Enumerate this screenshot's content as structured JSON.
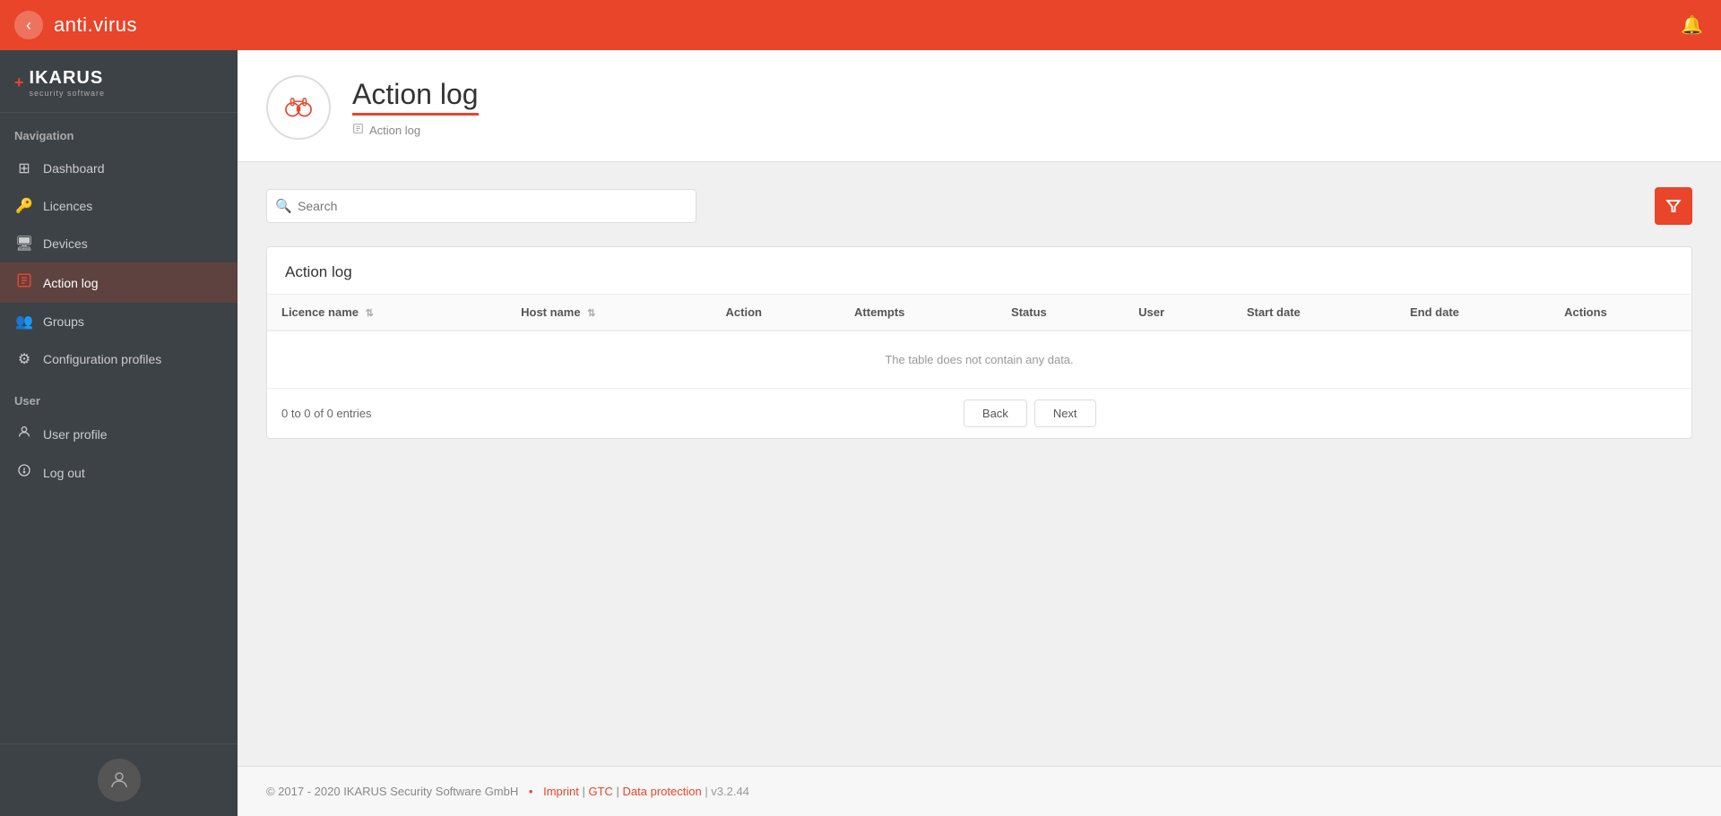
{
  "topbar": {
    "title": "anti.virus",
    "back_label": "‹"
  },
  "sidebar": {
    "logo_cross": "+",
    "logo_name": "IKARUS",
    "logo_sub": "security software",
    "nav_label": "Navigation",
    "nav_items": [
      {
        "id": "dashboard",
        "label": "Dashboard",
        "icon": "⊞",
        "active": false
      },
      {
        "id": "licences",
        "label": "Licences",
        "icon": "🔑",
        "active": false
      },
      {
        "id": "devices",
        "label": "Devices",
        "icon": "🖥",
        "active": false
      },
      {
        "id": "action-log",
        "label": "Action log",
        "icon": "📋",
        "active": true
      },
      {
        "id": "groups",
        "label": "Groups",
        "icon": "👥",
        "active": false
      },
      {
        "id": "configuration-profiles",
        "label": "Configuration profiles",
        "icon": "⚙",
        "active": false
      }
    ],
    "user_label": "User",
    "user_items": [
      {
        "id": "user-profile",
        "label": "User profile",
        "icon": "👤"
      },
      {
        "id": "log-out",
        "label": "Log out",
        "icon": "⏻"
      }
    ]
  },
  "page": {
    "title": "Action log",
    "icon": "🔭",
    "breadcrumb_icon": "📋",
    "breadcrumb_label": "Action log"
  },
  "search": {
    "placeholder": "Search"
  },
  "table": {
    "section_title": "Action log",
    "columns": [
      {
        "id": "licence-name",
        "label": "Licence name",
        "sortable": true
      },
      {
        "id": "host-name",
        "label": "Host name",
        "sortable": true
      },
      {
        "id": "action",
        "label": "Action",
        "sortable": false
      },
      {
        "id": "attempts",
        "label": "Attempts",
        "sortable": false
      },
      {
        "id": "status",
        "label": "Status",
        "sortable": false
      },
      {
        "id": "user",
        "label": "User",
        "sortable": false
      },
      {
        "id": "start-date",
        "label": "Start date",
        "sortable": false
      },
      {
        "id": "end-date",
        "label": "End date",
        "sortable": false
      },
      {
        "id": "actions",
        "label": "Actions",
        "sortable": false
      }
    ],
    "empty_message": "The table does not contain any data.",
    "entries_label": "0 to 0 of 0 entries"
  },
  "pagination": {
    "back_label": "Back",
    "next_label": "Next"
  },
  "footer": {
    "copyright": "© 2017 - 2020 IKARUS Security Software GmbH",
    "dot": "•",
    "imprint": "Imprint",
    "gtc": "GTC",
    "data_protection": "Data protection",
    "separator": " | ",
    "version": "| v3.2.44"
  }
}
